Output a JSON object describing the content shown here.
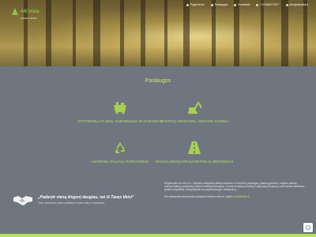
{
  "brand": {
    "name": "AK'vista",
    "tagline": "statybos darbai",
    "color": "#8bc34a"
  },
  "nav": [
    {
      "label": "Pagrindinis"
    },
    {
      "label": "Paslaugos"
    },
    {
      "label": "Kontaktai"
    },
    {
      "label": "+37064477877"
    },
    {
      "label": "info@akvista.lt"
    }
  ],
  "services_title": "Paslaugos",
  "services": [
    {
      "label": "STATYBINIŲ ATLIEKŲ SURINKIMAS IR IŠVEŽIMAS",
      "icon": "container-icon"
    },
    {
      "label": "PASTATŲ GRIOVIMO, ARDYMO DARBAI",
      "icon": "excavator-icon"
    },
    {
      "label": "ANTRINIŲ ŽALIAVŲ PARDAVIMAS",
      "icon": "recycle-icon"
    },
    {
      "label": "KELIŲ/LAIKINŲ KELIŲ/AIKŠTELIŲ ĮRENGIMAS",
      "icon": "road-icon"
    }
  ],
  "quote": {
    "text": "„Padaryk vieną žingsnį daugiau, nei iš Tavęs tikisi“",
    "sub": "Visus atliekamus darbus atliksime sutartu laiku ir kokybiškai."
  },
  "about": {
    "p1": "Registruota nuo 2012 m. Vykdome statybinių atliekų surinkimo ir išvežimo paslaugas, pastatų griovimo, ardymo darbus, antrinių žaliavų pardavimą, kelių bei aikštelių įrengimą. Turime nuosavą techniką ir patyrusią komandą, todėl darbus atliekame greitai, kokybiškai ir laikydamiesi visų aplinkosaugos reikalavimų.",
    "p2": "Dėl detalesnės informacijos kreipkitės telefonu arba el. paštu ",
    "email": "info@akvista.lt"
  },
  "colors": {
    "accent": "#b8e05a",
    "background": "#6f7680"
  }
}
